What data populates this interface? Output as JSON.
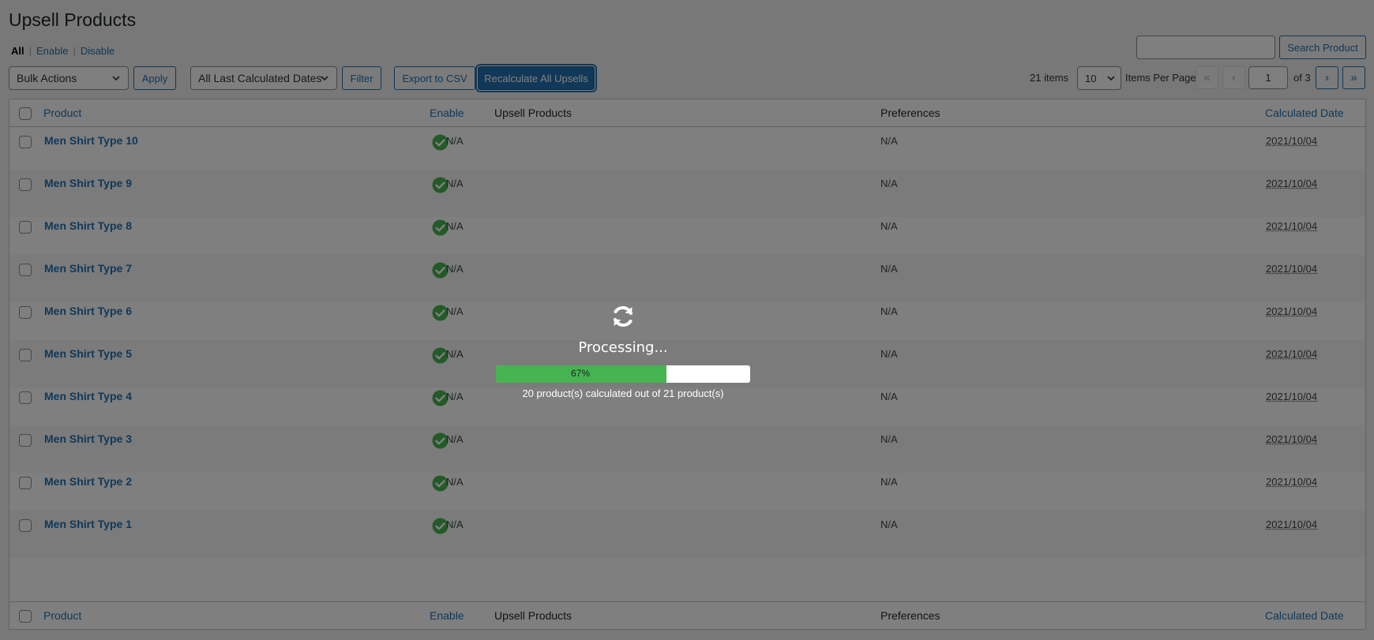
{
  "page": {
    "title": "Upsell Products",
    "filters": {
      "all": "All",
      "enable": "Enable",
      "disable": "Disable"
    }
  },
  "toolbar": {
    "bulk_actions": "Bulk Actions",
    "apply": "Apply",
    "dates": "All Last Calculated Dates",
    "filter": "Filter",
    "export": "Export to CSV",
    "recalculate": "Recalculate All Upsells",
    "search_button": "Search Product",
    "search_value": ""
  },
  "pagination": {
    "items_count": "21 items",
    "per_page_value": "10",
    "per_page_label": "Items Per Page",
    "first": "«",
    "prev": "‹",
    "current_page": "1",
    "of_pages": "of 3",
    "next": "›",
    "last": "»"
  },
  "table": {
    "columns": [
      "Product",
      "Enable",
      "Upsell Products",
      "Preferences",
      "Calculated Date"
    ],
    "rows": [
      {
        "product": "Men Shirt Type 10",
        "upsell": "N/A",
        "preferences": "N/A",
        "date": "2021/10/04"
      },
      {
        "product": "Men Shirt Type 9",
        "upsell": "N/A",
        "preferences": "N/A",
        "date": "2021/10/04"
      },
      {
        "product": "Men Shirt Type 8",
        "upsell": "N/A",
        "preferences": "N/A",
        "date": "2021/10/04"
      },
      {
        "product": "Men Shirt Type 7",
        "upsell": "N/A",
        "preferences": "N/A",
        "date": "2021/10/04"
      },
      {
        "product": "Men Shirt Type 6",
        "upsell": "N/A",
        "preferences": "N/A",
        "date": "2021/10/04"
      },
      {
        "product": "Men Shirt Type 5",
        "upsell": "N/A",
        "preferences": "N/A",
        "date": "2021/10/04"
      },
      {
        "product": "Men Shirt Type 4",
        "upsell": "N/A",
        "preferences": "N/A",
        "date": "2021/10/04"
      },
      {
        "product": "Men Shirt Type 3",
        "upsell": "N/A",
        "preferences": "N/A",
        "date": "2021/10/04"
      },
      {
        "product": "Men Shirt Type 2",
        "upsell": "N/A",
        "preferences": "N/A",
        "date": "2021/10/04"
      },
      {
        "product": "Men Shirt Type 1",
        "upsell": "N/A",
        "preferences": "N/A",
        "date": "2021/10/04"
      }
    ]
  },
  "processing": {
    "label": "Processing...",
    "progress": 0.67,
    "progress_text": "67%",
    "status_text": "20 product(s) calculated out of 21 product(s)"
  },
  "icons": {
    "enabled": "check-circle-icon",
    "spinner": "refresh-icon",
    "dropdown": "chevron-down-icon"
  },
  "colors": {
    "link": "#2271b1",
    "enabled": "#46b450",
    "progress": "#46b450"
  }
}
